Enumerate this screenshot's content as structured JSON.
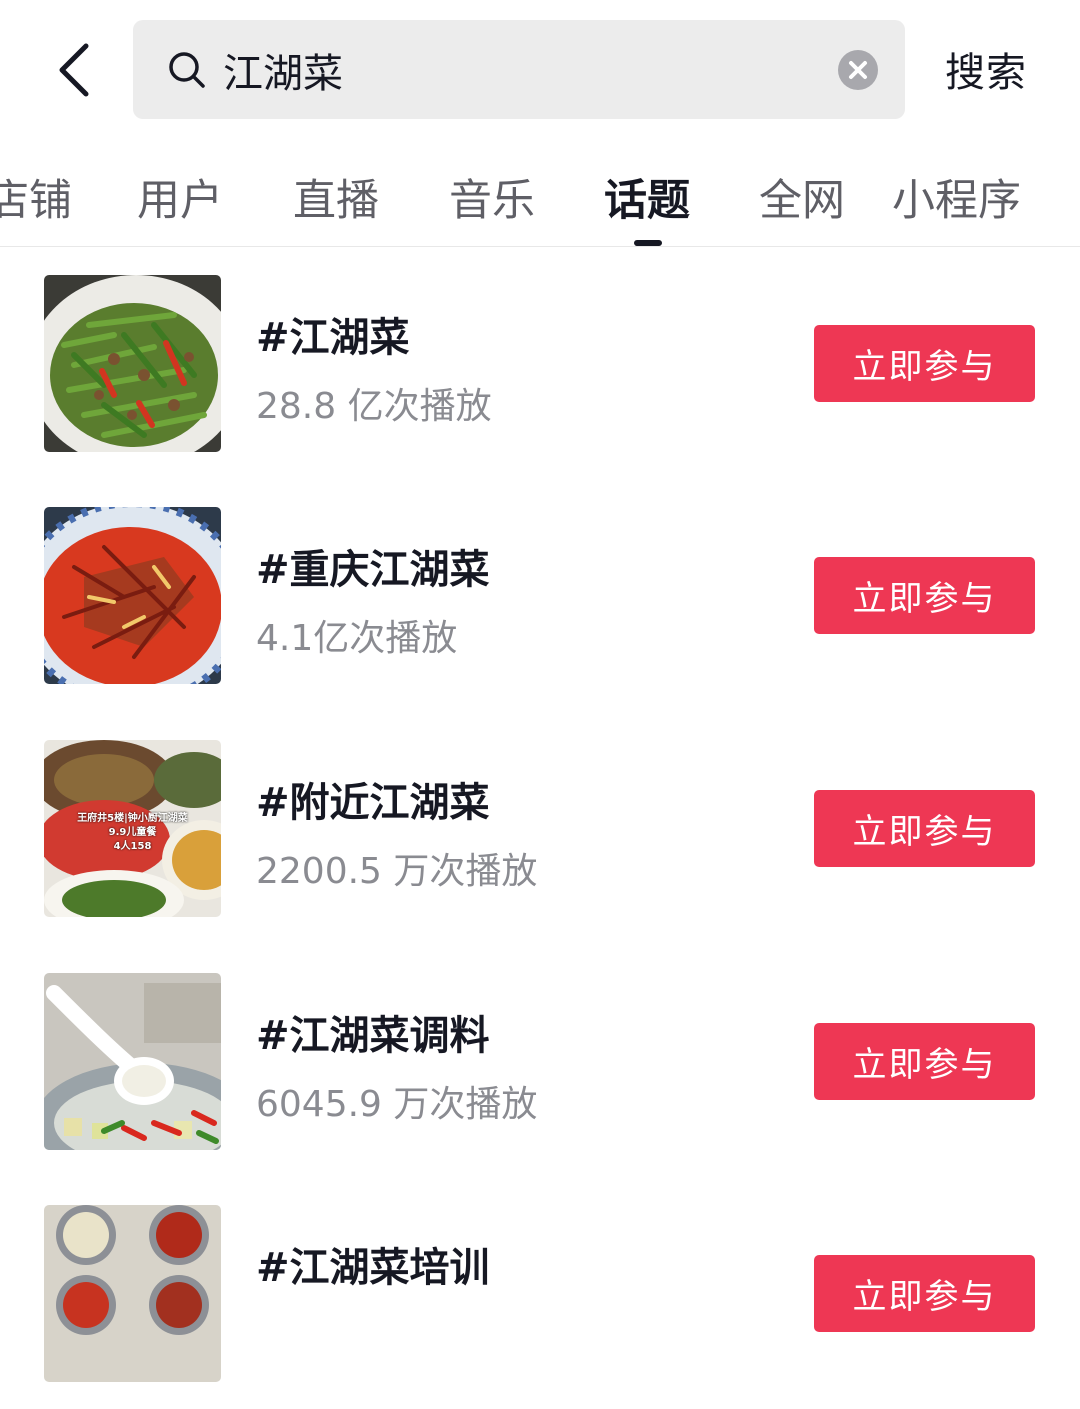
{
  "search": {
    "value": "江湖菜",
    "submit_label": "搜索"
  },
  "tabs": [
    {
      "label": "店铺"
    },
    {
      "label": "用户"
    },
    {
      "label": "直播"
    },
    {
      "label": "音乐"
    },
    {
      "label": "话题",
      "active": true
    },
    {
      "label": "全网"
    },
    {
      "label": "小程序"
    }
  ],
  "topics": [
    {
      "title": "#江湖菜",
      "views": "28.8 亿次播放",
      "action": "立即参与"
    },
    {
      "title": "#重庆江湖菜",
      "views": "4.1亿次播放",
      "action": "立即参与"
    },
    {
      "title": "#附近江湖菜",
      "views": "2200.5 万次播放",
      "action": "立即参与",
      "thumb_text": [
        "王府井5楼|钟小厨江湖菜",
        "9.9儿童餐",
        "4人158"
      ]
    },
    {
      "title": "#江湖菜调料",
      "views": "6045.9 万次播放",
      "action": "立即参与"
    },
    {
      "title": "#江湖菜培训",
      "views": "",
      "action": "立即参与"
    }
  ],
  "colors": {
    "accent": "#ee3754",
    "text_primary": "#161823",
    "text_secondary": "#8a8b91",
    "search_bg": "#ececec"
  }
}
